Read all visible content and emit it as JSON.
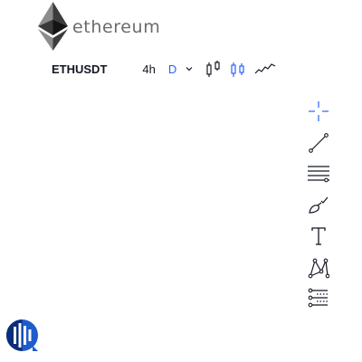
{
  "brand": {
    "name": "ethereum",
    "text_color": "#6b6b6b"
  },
  "header": {
    "symbol": "ETHUSDT",
    "intervals": [
      {
        "label": "4h",
        "active": false
      },
      {
        "label": "D",
        "active": true
      }
    ],
    "accent_color": "#2962ff",
    "chart_style_icons": [
      "bars-icon",
      "candles-icon",
      "line-icon"
    ],
    "dropdown_icon": "chevron-down-icon"
  },
  "drawing_tools": [
    {
      "name": "crosshair",
      "icon": "crosshair-icon",
      "active": true
    },
    {
      "name": "trend-line",
      "icon": "trend-line-icon",
      "active": false
    },
    {
      "name": "fib-retracement",
      "icon": "fib-retracement-icon",
      "active": false
    },
    {
      "name": "brush",
      "icon": "brush-icon",
      "active": false
    },
    {
      "name": "text",
      "icon": "text-icon",
      "active": false
    },
    {
      "name": "pattern",
      "icon": "pattern-icon",
      "active": false
    },
    {
      "name": "prediction",
      "icon": "prediction-icon",
      "active": false
    }
  ],
  "footer": {
    "logo_icon": "tradingview-logo-icon",
    "logo_color": "#1e5ccc"
  }
}
